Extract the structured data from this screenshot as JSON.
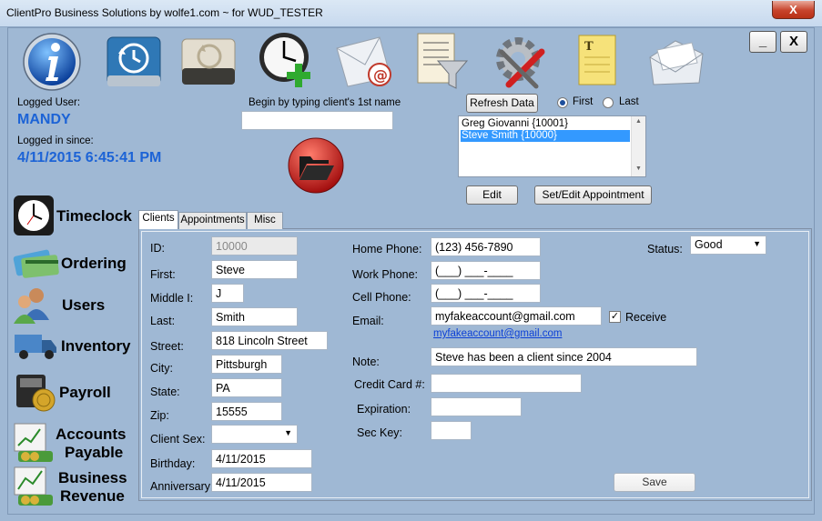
{
  "window": {
    "title": "ClientPro Business Solutions by wolfe1.com ~ for WUD_TESTER",
    "close_label": "X"
  },
  "toolbar": {
    "icons": [
      {
        "name": "info-icon"
      },
      {
        "name": "backup-icon"
      },
      {
        "name": "restore-icon"
      },
      {
        "name": "add-clock-icon"
      },
      {
        "name": "email-icon"
      },
      {
        "name": "filter-list-icon"
      },
      {
        "name": "settings-tools-icon"
      },
      {
        "name": "notepad-icon"
      },
      {
        "name": "open-mail-icon"
      }
    ],
    "minimize_label": "_",
    "close_label": "X"
  },
  "session": {
    "logged_user_label": "Logged User:",
    "logged_user": "MANDY",
    "logged_since_label": "Logged in since:",
    "logged_since": "4/11/2015 6:45:41 PM"
  },
  "search": {
    "label": "Begin by typing client's 1st name",
    "value": ""
  },
  "list_controls": {
    "refresh_label": "Refresh Data",
    "sort_first_label": "First",
    "sort_last_label": "Last",
    "sort_selected": "First",
    "clients": [
      "Greg Giovanni {10001}",
      "Steve Smith {10000}"
    ],
    "selected_index": 1,
    "edit_label": "Edit",
    "appointment_label": "Set/Edit Appointment"
  },
  "sidebar": {
    "items": [
      {
        "label": "Timeclock"
      },
      {
        "label": "Ordering"
      },
      {
        "label": "Users"
      },
      {
        "label": "Inventory"
      },
      {
        "label": "Payroll"
      },
      {
        "label_line1": "Accounts",
        "label_line2": "Payable"
      },
      {
        "label_line1": "Business",
        "label_line2": "Revenue"
      }
    ]
  },
  "tabs": [
    "Clients",
    "Appointments",
    "Misc"
  ],
  "client_form": {
    "id_label": "ID:",
    "id": "10000",
    "first_label": "First:",
    "first": "Steve",
    "middle_label": "Middle I:",
    "middle": "J",
    "last_label": "Last:",
    "last": "Smith",
    "street_label": "Street:",
    "street": "818 Lincoln Street",
    "city_label": "City:",
    "city": "Pittsburgh",
    "state_label": "State:",
    "state": "PA",
    "zip_label": "Zip:",
    "zip": "15555",
    "sex_label": "Client Sex:",
    "sex": "",
    "birthday_label": "Birthday:",
    "birthday": "4/11/2015",
    "anniversary_label": "Anniversary:",
    "anniversary": "4/11/2015",
    "home_phone_label": "Home Phone:",
    "home_phone": "(123) 456-7890",
    "work_phone_label": "Work Phone:",
    "work_phone": "(___) ___-____",
    "cell_phone_label": "Cell Phone:",
    "cell_phone": "(___) ___-____",
    "email_label": "Email:",
    "email": "myfakeaccount@gmail.com",
    "receive_label": "Receive",
    "receive_checked": true,
    "email_link": "myfakeaccount@gmail.com",
    "note_label": "Note:",
    "note": "Steve has been a client since 2004",
    "credit_card_label": "Credit Card #:",
    "credit_card": "",
    "expiration_label": "Expiration:",
    "expiration": "",
    "sec_key_label": "Sec Key:",
    "sec_key": "",
    "status_label": "Status:",
    "status": "Good",
    "save_label": "Save"
  },
  "colors": {
    "background": "#9fb8d4",
    "accent_blue": "#1c63d6",
    "selection": "#3399ff",
    "title_close": "#c7432b"
  }
}
